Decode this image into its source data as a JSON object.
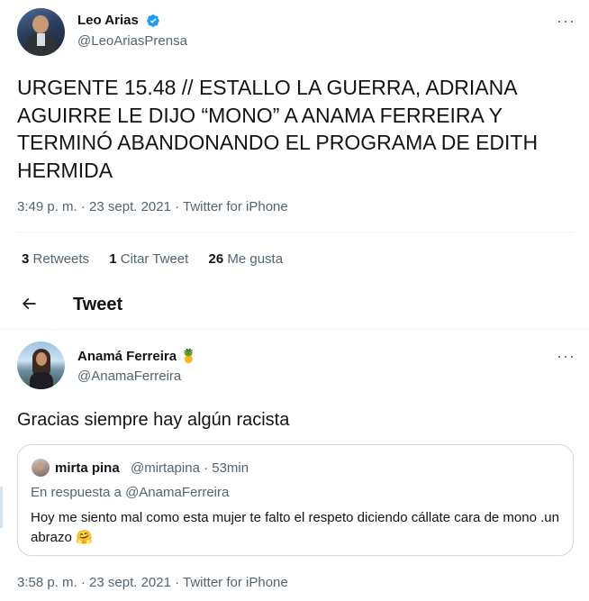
{
  "tweet1": {
    "author_name": "Leo Arias",
    "author_handle": "@LeoAriasPrensa",
    "verified_icon": "verified-badge-icon",
    "text": "URGENTE 15.48 // ESTALLO LA GUERRA, ADRIANA AGUIRRE LE DIJO “MONO” A ANAMA FERREIRA Y TERMINÓ ABANDONANDO EL PROGRAMA DE EDITH HERMIDA",
    "timestamp": "3:49 p. m. · 23 sept. 2021 · Twitter for iPhone",
    "stats": {
      "retweets_count": "3",
      "retweets_label": "Retweets",
      "quotes_count": "1",
      "quotes_label": "Citar Tweet",
      "likes_count": "26",
      "likes_label": "Me gusta"
    },
    "more_label": "···"
  },
  "header": {
    "back_icon": "arrow-left-icon",
    "title": "Tweet"
  },
  "tweet2": {
    "author_name": "Anamá Ferreira",
    "author_emoji": "🍍",
    "author_handle": "@AnamaFerreira",
    "more_label": "···",
    "text": "Gracias siempre hay algún racista",
    "quoted": {
      "author_name": "mirta pina",
      "author_handle_time": "@mirtapina · 53min",
      "reply_to": "En respuesta a @AnamaFerreira",
      "text": "Hoy me siento mal como esta mujer te falto el respeto diciendo cállate cara de mono .un abrazo 🤗"
    },
    "timestamp": "3:58 p. m. · 23 sept. 2021 · Twitter for iPhone"
  },
  "colors": {
    "text_primary": "#0f1419",
    "text_secondary": "#536471",
    "verified_blue": "#1d9bf0",
    "border": "#cfd9de",
    "divider": "#eff3f4"
  }
}
